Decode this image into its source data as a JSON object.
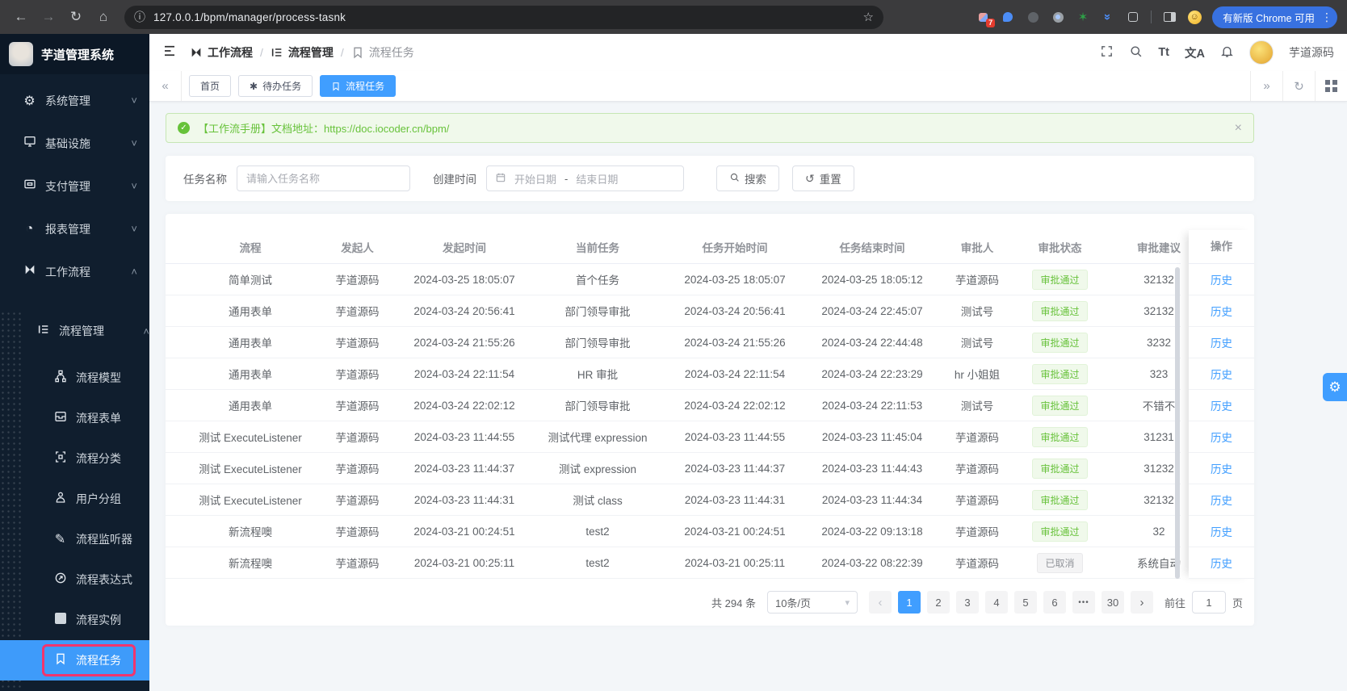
{
  "browser": {
    "url": "127.0.0.1/bpm/manager/process-tasnk",
    "ext_badge": "7",
    "update_label": "有新版 Chrome 可用"
  },
  "sidebar": {
    "title": "芋道管理系统",
    "items": [
      {
        "label": "系统管理"
      },
      {
        "label": "基础设施"
      },
      {
        "label": "支付管理"
      },
      {
        "label": "报表管理"
      },
      {
        "label": "工作流程"
      }
    ],
    "process_mgmt": "流程管理",
    "children": [
      {
        "label": "流程模型"
      },
      {
        "label": "流程表单"
      },
      {
        "label": "流程分类"
      },
      {
        "label": "用户分组"
      },
      {
        "label": "流程监听器"
      },
      {
        "label": "流程表达式"
      },
      {
        "label": "流程实例"
      },
      {
        "label": "流程任务"
      }
    ]
  },
  "header": {
    "breadcrumb": [
      "工作流程",
      "流程管理",
      "流程任务"
    ],
    "breadcrumb_sep": "/",
    "fontsize_icon": "Tt",
    "translate_icon": "文A",
    "username": "芋道源码"
  },
  "tabs": [
    {
      "label": "首页"
    },
    {
      "label": "待办任务"
    },
    {
      "label": "流程任务"
    }
  ],
  "alert": {
    "text": "【工作流手册】文档地址：",
    "link": "https://doc.iocoder.cn/bpm/",
    "close": "×"
  },
  "filter": {
    "name_label": "任务名称",
    "name_placeholder": "请输入任务名称",
    "time_label": "创建时间",
    "start_placeholder": "开始日期",
    "separator": "-",
    "end_placeholder": "结束日期",
    "search": "搜索",
    "reset": "重置"
  },
  "table": {
    "headers": [
      "流程",
      "发起人",
      "发起时间",
      "当前任务",
      "任务开始时间",
      "任务结束时间",
      "审批人",
      "审批状态",
      "审批建议",
      "操作"
    ],
    "history": "历史",
    "rows": [
      {
        "process": "简单测试",
        "starter": "芋道源码",
        "start_time": "2024-03-25 18:05:07",
        "task": "首个任务",
        "task_start": "2024-03-25 18:05:07",
        "task_end": "2024-03-25 18:05:12",
        "approver": "芋道源码",
        "status": "审批通过",
        "status_type": "success",
        "opinion": "32132"
      },
      {
        "process": "通用表单",
        "starter": "芋道源码",
        "start_time": "2024-03-24 20:56:41",
        "task": "部门领导审批",
        "task_start": "2024-03-24 20:56:41",
        "task_end": "2024-03-24 22:45:07",
        "approver": "测试号",
        "status": "审批通过",
        "status_type": "success",
        "opinion": "32132"
      },
      {
        "process": "通用表单",
        "starter": "芋道源码",
        "start_time": "2024-03-24 21:55:26",
        "task": "部门领导审批",
        "task_start": "2024-03-24 21:55:26",
        "task_end": "2024-03-24 22:44:48",
        "approver": "测试号",
        "status": "审批通过",
        "status_type": "success",
        "opinion": "3232"
      },
      {
        "process": "通用表单",
        "starter": "芋道源码",
        "start_time": "2024-03-24 22:11:54",
        "task": "HR 审批",
        "task_start": "2024-03-24 22:11:54",
        "task_end": "2024-03-24 22:23:29",
        "approver": "hr 小姐姐",
        "status": "审批通过",
        "status_type": "success",
        "opinion": "323"
      },
      {
        "process": "通用表单",
        "starter": "芋道源码",
        "start_time": "2024-03-24 22:02:12",
        "task": "部门领导审批",
        "task_start": "2024-03-24 22:02:12",
        "task_end": "2024-03-24 22:11:53",
        "approver": "测试号",
        "status": "审批通过",
        "status_type": "success",
        "opinion": "不错不"
      },
      {
        "process": "测试 ExecuteListener",
        "starter": "芋道源码",
        "start_time": "2024-03-23 11:44:55",
        "task": "测试代理 expression",
        "task_start": "2024-03-23 11:44:55",
        "task_end": "2024-03-23 11:45:04",
        "approver": "芋道源码",
        "status": "审批通过",
        "status_type": "success",
        "opinion": "31231"
      },
      {
        "process": "测试 ExecuteListener",
        "starter": "芋道源码",
        "start_time": "2024-03-23 11:44:37",
        "task": "测试 expression",
        "task_start": "2024-03-23 11:44:37",
        "task_end": "2024-03-23 11:44:43",
        "approver": "芋道源码",
        "status": "审批通过",
        "status_type": "success",
        "opinion": "31232"
      },
      {
        "process": "测试 ExecuteListener",
        "starter": "芋道源码",
        "start_time": "2024-03-23 11:44:31",
        "task": "测试 class",
        "task_start": "2024-03-23 11:44:31",
        "task_end": "2024-03-23 11:44:34",
        "approver": "芋道源码",
        "status": "审批通过",
        "status_type": "success",
        "opinion": "32132"
      },
      {
        "process": "新流程噢",
        "starter": "芋道源码",
        "start_time": "2024-03-21 00:24:51",
        "task": "test2",
        "task_start": "2024-03-21 00:24:51",
        "task_end": "2024-03-22 09:13:18",
        "approver": "芋道源码",
        "status": "审批通过",
        "status_type": "success",
        "opinion": "32"
      },
      {
        "process": "新流程噢",
        "starter": "芋道源码",
        "start_time": "2024-03-21 00:25:11",
        "task": "test2",
        "task_start": "2024-03-21 00:25:11",
        "task_end": "2024-03-22 08:22:39",
        "approver": "芋道源码",
        "status": "已取消",
        "status_type": "info",
        "opinion": "系统自动"
      }
    ]
  },
  "pagination": {
    "total": "共 294 条",
    "page_size": "10条/页",
    "pages": [
      {
        "label": "1",
        "active": true
      },
      {
        "label": "2",
        "active": false
      },
      {
        "label": "3",
        "active": false
      },
      {
        "label": "4",
        "active": false
      },
      {
        "label": "5",
        "active": false
      },
      {
        "label": "6",
        "active": false
      }
    ],
    "ellipsis": "•••",
    "last": "30",
    "goto": "前往",
    "goto_value": "1",
    "unit": "页"
  }
}
